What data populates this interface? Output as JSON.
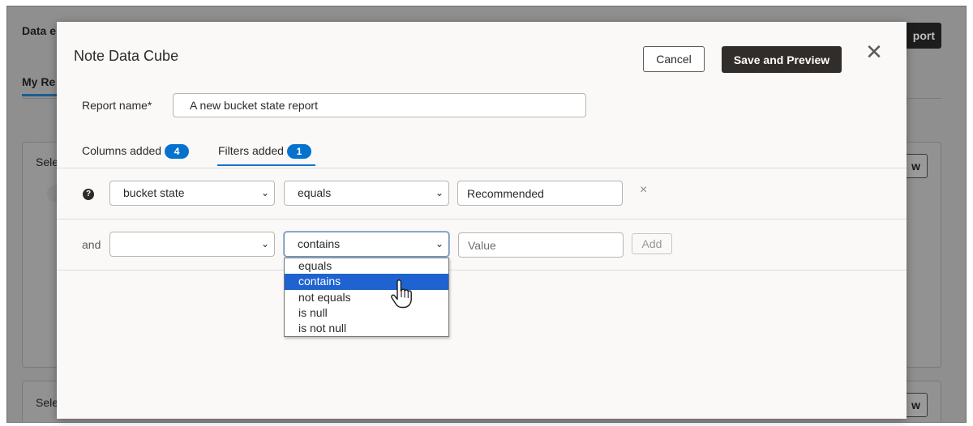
{
  "background": {
    "page_title": "Data e",
    "tab_label": "My Re",
    "top_button_label": "port",
    "card1_label": "Sele",
    "card1_button_label": "w",
    "card2_label": "Sele",
    "card2_button_label": "w"
  },
  "modal": {
    "title": "Note Data Cube",
    "cancel_label": "Cancel",
    "save_label": "Save and Preview",
    "report_name_label": "Report name*",
    "report_name_value": "A new bucket state report",
    "tabs": [
      {
        "label": "Columns added",
        "count": "4",
        "active": false
      },
      {
        "label": "Filters added",
        "count": "1",
        "active": true
      }
    ],
    "filters": [
      {
        "field": "bucket state",
        "operator": "equals",
        "value": "Recommended"
      }
    ],
    "new_filter": {
      "conjunction_label": "and",
      "field": "",
      "operator": "contains",
      "value_placeholder": "Value",
      "add_label": "Add",
      "operator_options": [
        "equals",
        "contains",
        "not equals",
        "is null",
        "is not null"
      ],
      "highlighted_option": "contains"
    }
  },
  "colors": {
    "accent_blue": "#0572ce",
    "primary_button": "#312d2a",
    "dropdown_highlight": "#1e63d0"
  },
  "icons": {
    "close": "close-icon",
    "help": "help-icon",
    "remove": "remove-filter-icon",
    "chevron": "chevron-down-icon",
    "cursor": "hand-pointer-icon"
  }
}
